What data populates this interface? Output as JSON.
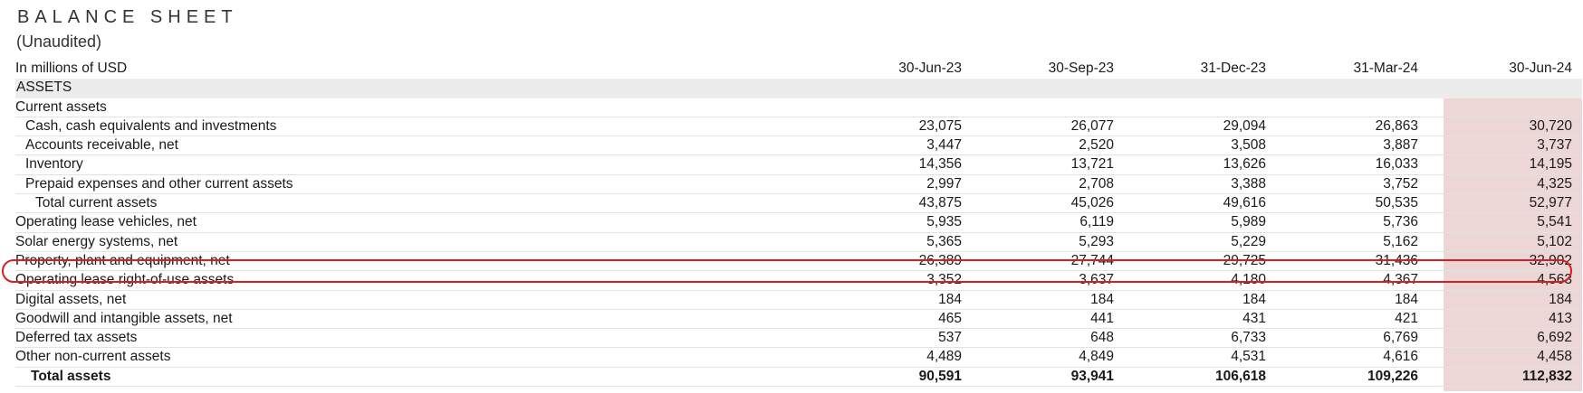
{
  "title": "BALANCE SHEET",
  "subtitle": "(Unaudited)",
  "unit_label": "In millions of USD",
  "columns": [
    "30-Jun-23",
    "30-Sep-23",
    "31-Dec-23",
    "31-Mar-24",
    "30-Jun-24"
  ],
  "highlight_color": "#edd6d6",
  "circle_color": "#d81e1e",
  "rows": [
    {
      "label": "ASSETS",
      "values": [
        "",
        "",
        "",
        "",
        ""
      ]
    },
    {
      "label": "Current assets",
      "values": [
        "",
        "",
        "",
        "",
        ""
      ]
    },
    {
      "label": "Cash, cash equivalents and investments",
      "values": [
        "23,075",
        "26,077",
        "29,094",
        "26,863",
        "30,720"
      ]
    },
    {
      "label": "Accounts receivable, net",
      "values": [
        "3,447",
        "2,520",
        "3,508",
        "3,887",
        "3,737"
      ]
    },
    {
      "label": "Inventory",
      "values": [
        "14,356",
        "13,721",
        "13,626",
        "16,033",
        "14,195"
      ]
    },
    {
      "label": "Prepaid expenses and other current assets",
      "values": [
        "2,997",
        "2,708",
        "3,388",
        "3,752",
        "4,325"
      ]
    },
    {
      "label": "Total current assets",
      "values": [
        "43,875",
        "45,026",
        "49,616",
        "50,535",
        "52,977"
      ]
    },
    {
      "label": "Operating lease vehicles, net",
      "values": [
        "5,935",
        "6,119",
        "5,989",
        "5,736",
        "5,541"
      ]
    },
    {
      "label": "Solar energy systems, net",
      "values": [
        "5,365",
        "5,293",
        "5,229",
        "5,162",
        "5,102"
      ]
    },
    {
      "label": "Property, plant and equipment, net",
      "values": [
        "26,389",
        "27,744",
        "29,725",
        "31,436",
        "32,902"
      ]
    },
    {
      "label": "Operating lease right-of-use assets",
      "values": [
        "3,352",
        "3,637",
        "4,180",
        "4,367",
        "4,563"
      ]
    },
    {
      "label": "Digital assets, net",
      "values": [
        "184",
        "184",
        "184",
        "184",
        "184"
      ]
    },
    {
      "label": "Goodwill and intangible assets, net",
      "values": [
        "465",
        "441",
        "431",
        "421",
        "413"
      ]
    },
    {
      "label": "Deferred tax assets",
      "values": [
        "537",
        "648",
        "6,733",
        "6,769",
        "6,692"
      ]
    },
    {
      "label": "Other non-current assets",
      "values": [
        "4,489",
        "4,849",
        "4,531",
        "4,616",
        "4,458"
      ]
    },
    {
      "label": "Total assets",
      "values": [
        "90,591",
        "93,941",
        "106,618",
        "109,226",
        "112,832"
      ]
    }
  ]
}
